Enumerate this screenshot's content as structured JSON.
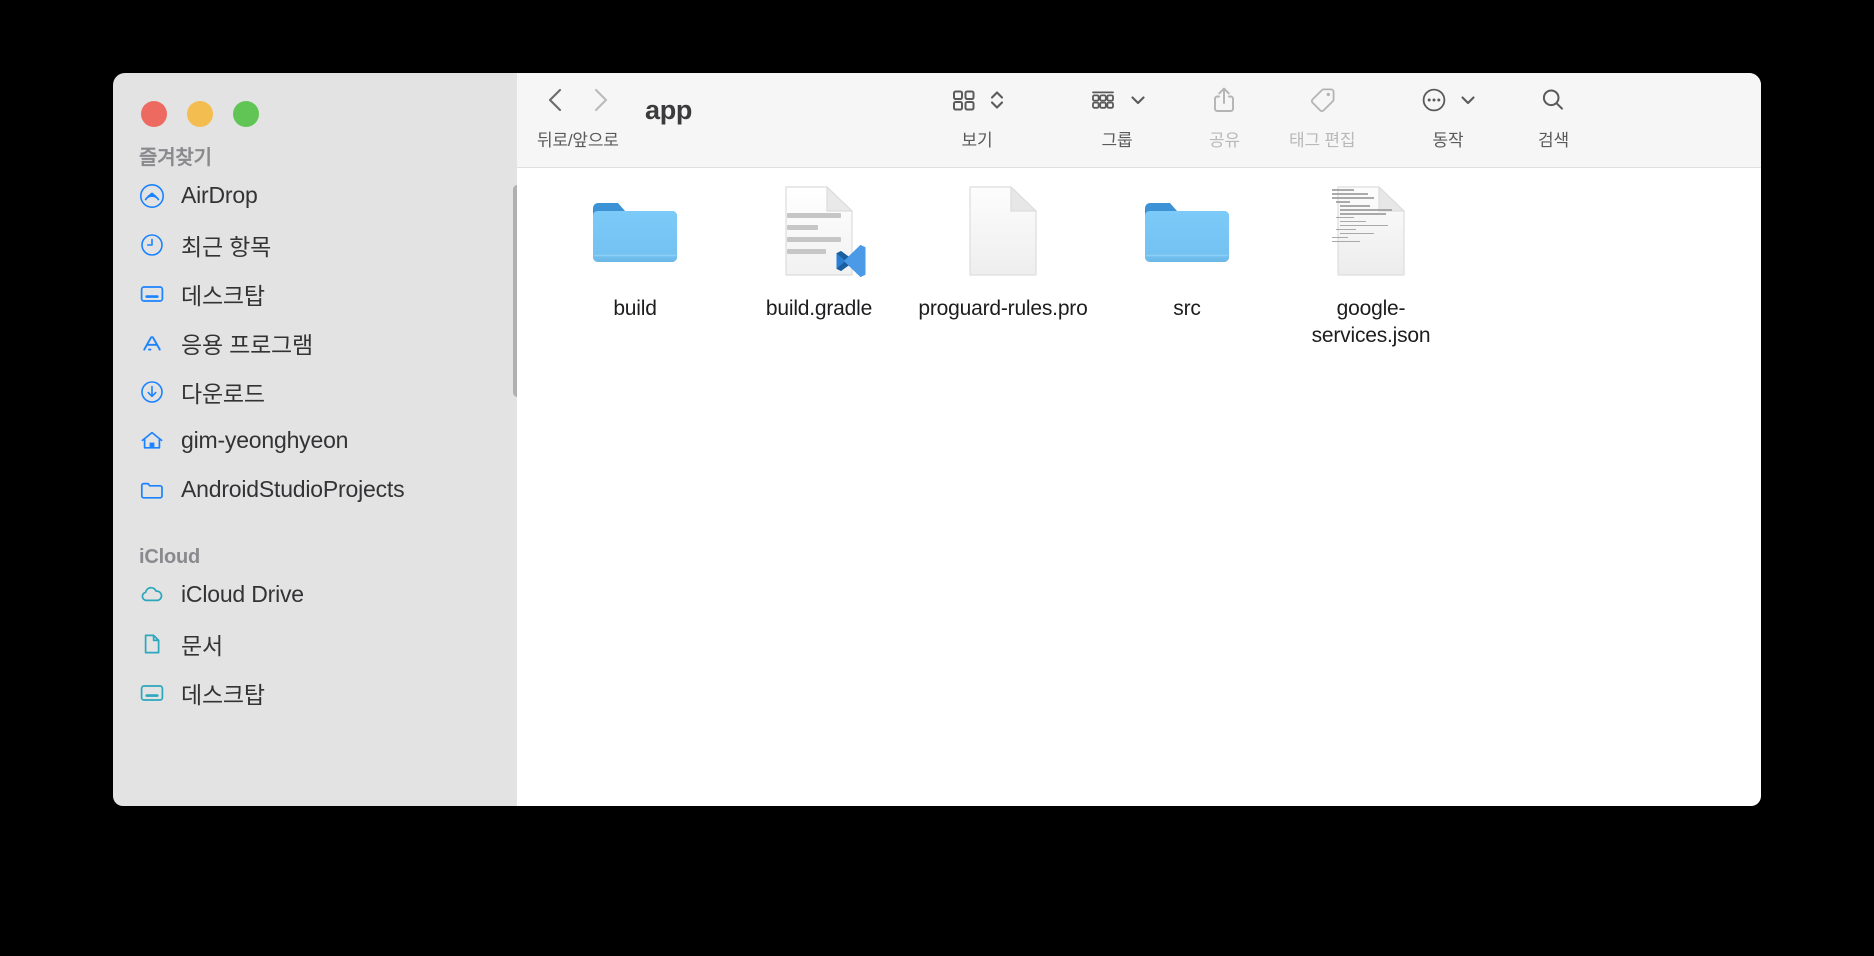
{
  "window": {
    "title": "app",
    "traffic_lights": [
      {
        "name": "close",
        "color": "#ec6a5f"
      },
      {
        "name": "minimize",
        "color": "#f4bd4f"
      },
      {
        "name": "maximize",
        "color": "#61c555"
      }
    ]
  },
  "toolbar": {
    "nav_caption": "뒤로/앞으로",
    "items": [
      {
        "id": "view",
        "icon": "grid-view-icon",
        "label": "보기",
        "enabled": true,
        "has_chevron": true
      },
      {
        "id": "group",
        "icon": "group-rows-icon",
        "label": "그룹",
        "enabled": true,
        "has_chevron": true
      },
      {
        "id": "share",
        "icon": "share-icon",
        "label": "공유",
        "enabled": false,
        "has_chevron": false
      },
      {
        "id": "tags",
        "icon": "tag-icon",
        "label": "태그 편집",
        "enabled": false,
        "has_chevron": false
      },
      {
        "id": "action",
        "icon": "ellipsis-circle-icon",
        "label": "동작",
        "enabled": true,
        "has_chevron": true
      },
      {
        "id": "search",
        "icon": "search-icon",
        "label": "검색",
        "enabled": true,
        "has_chevron": false
      }
    ]
  },
  "sidebar": {
    "sections": [
      {
        "title": "즐겨찾기",
        "items": [
          {
            "label": "AirDrop",
            "icon": "airdrop-icon",
            "color": "#1b83ff"
          },
          {
            "label": "최근 항목",
            "icon": "clock-icon",
            "color": "#1b83ff"
          },
          {
            "label": "데스크탑",
            "icon": "desktop-icon",
            "color": "#1b83ff"
          },
          {
            "label": "응용 프로그램",
            "icon": "applications-icon",
            "color": "#1b83ff"
          },
          {
            "label": "다운로드",
            "icon": "download-circle-icon",
            "color": "#1b83ff"
          },
          {
            "label": "gim-yeonghyeon",
            "icon": "home-icon",
            "color": "#1b83ff"
          },
          {
            "label": "AndroidStudioProjects",
            "icon": "folder-icon",
            "color": "#1b83ff"
          }
        ]
      },
      {
        "title": "iCloud",
        "items": [
          {
            "label": "iCloud Drive",
            "icon": "cloud-icon",
            "color": "#2ba7bd"
          },
          {
            "label": "문서",
            "icon": "document-icon",
            "color": "#2ba7bd"
          },
          {
            "label": "데스크탑",
            "icon": "desktop-icon",
            "color": "#2ba7bd"
          }
        ]
      }
    ]
  },
  "files": [
    {
      "name": "build",
      "kind": "folder"
    },
    {
      "name": "build.gradle",
      "kind": "document-lines",
      "badge": "vscode-badge"
    },
    {
      "name": "proguard-rules.pro",
      "kind": "document-blank"
    },
    {
      "name": "src",
      "kind": "folder"
    },
    {
      "name": "google-services.json",
      "kind": "document-text-preview"
    }
  ],
  "colors": {
    "folder_top": "#3b92d4",
    "folder_body": "#76c5f5",
    "sidebar_bg": "#e3e3e3",
    "toolbar_bg": "#f6f6f6",
    "accent_blue": "#1b83ff",
    "icloud_teal": "#2ba7bd"
  }
}
